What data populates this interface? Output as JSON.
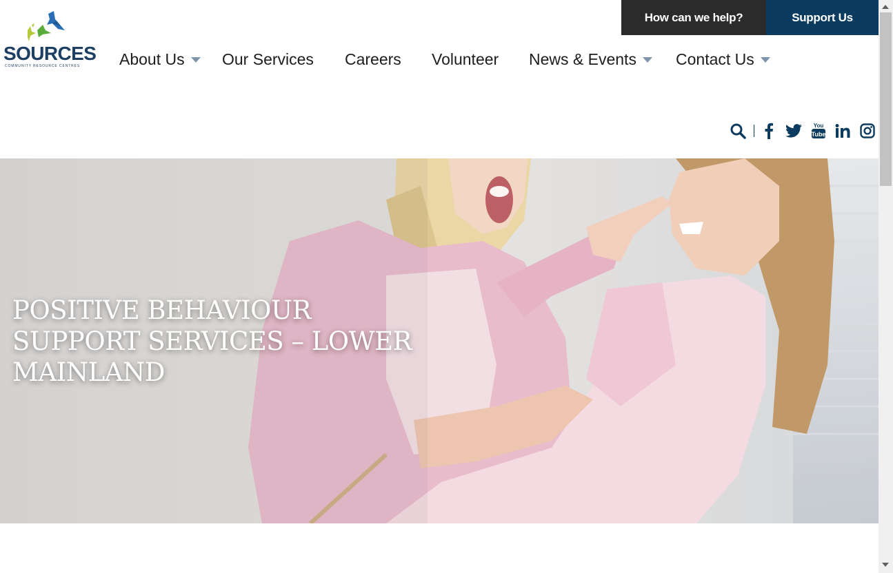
{
  "top_bar": {
    "help_label": "How can we help?",
    "support_label": "Support Us"
  },
  "logo": {
    "name": "SOURCES",
    "tagline": "COMMUNITY RESOURCE CENTRES"
  },
  "nav": {
    "items": [
      {
        "label": "About Us",
        "has_dropdown": true
      },
      {
        "label": "Our Services",
        "has_dropdown": false
      },
      {
        "label": "Careers",
        "has_dropdown": false
      },
      {
        "label": "Volunteer",
        "has_dropdown": false
      },
      {
        "label": "News & Events",
        "has_dropdown": true
      },
      {
        "label": "Contact Us",
        "has_dropdown": true
      }
    ]
  },
  "social_icons": [
    "search-icon",
    "facebook-icon",
    "twitter-icon",
    "youtube-icon",
    "linkedin-icon",
    "instagram-icon"
  ],
  "hero": {
    "title_line1": "POSITIVE BEHAVIOUR",
    "title_line2": "SUPPORT SERVICES – LOWER",
    "title_line3": "MAINLAND"
  },
  "colors": {
    "brand_navy": "#0b3b5e",
    "dark_button": "#2b2b2b",
    "caret": "#7d94ab"
  }
}
